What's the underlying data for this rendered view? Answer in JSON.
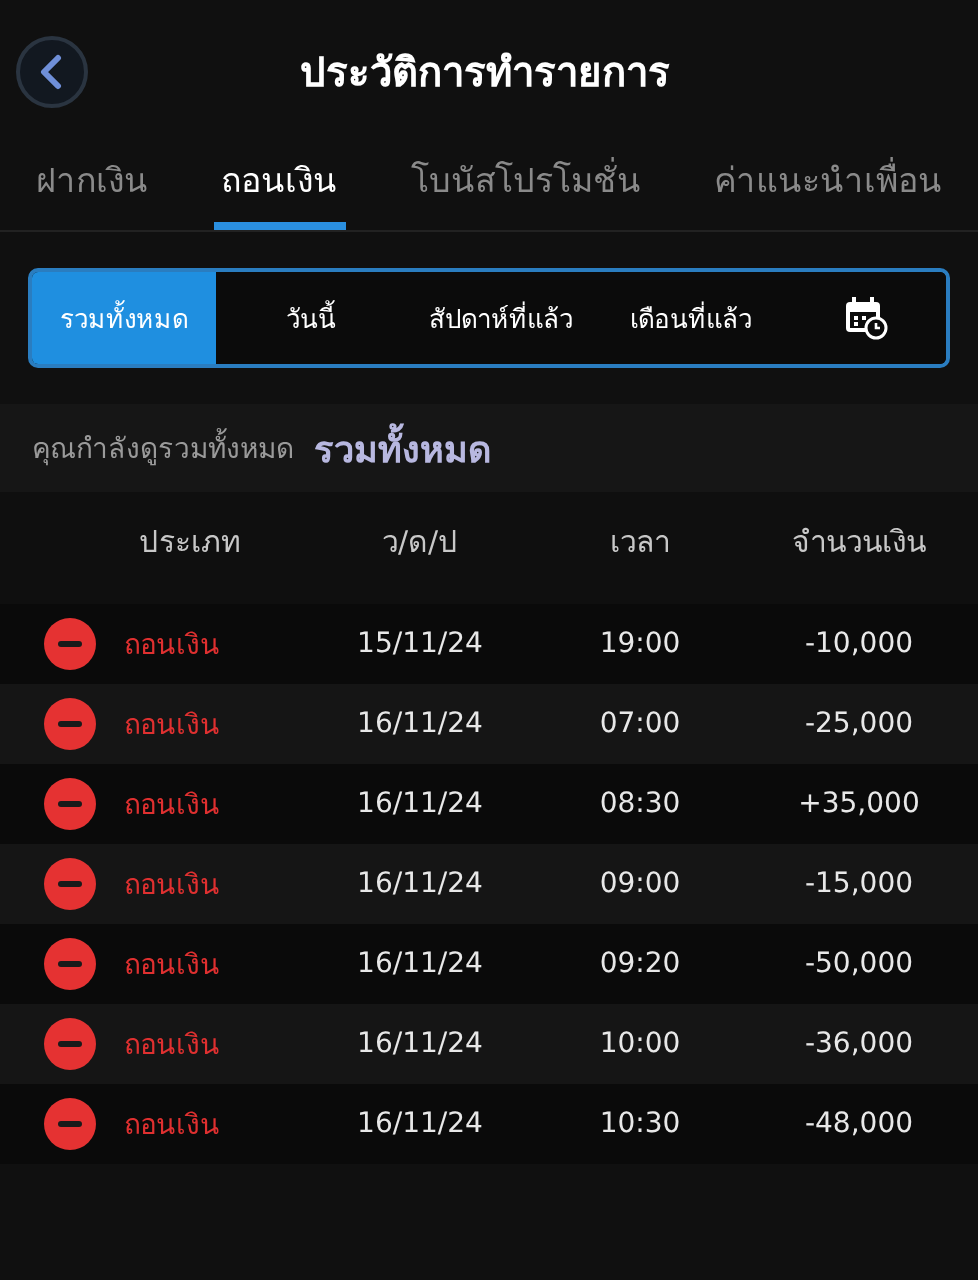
{
  "header": {
    "title": "ประวัติการทำรายการ"
  },
  "tabs": [
    {
      "label": "ฝากเงิน",
      "selected": false
    },
    {
      "label": "ถอนเงิน",
      "selected": true
    },
    {
      "label": "โบนัสโปรโมชั่น",
      "selected": false
    },
    {
      "label": "ค่าแนะนำเพื่อน",
      "selected": false
    }
  ],
  "filters": [
    {
      "label": "รวมทั้งหมด",
      "selected": true
    },
    {
      "label": "วันนี้",
      "selected": false
    },
    {
      "label": "สัปดาห์ที่แล้ว",
      "selected": false
    },
    {
      "label": "เดือนที่แล้ว",
      "selected": false
    }
  ],
  "viewing": {
    "caption": "คุณกำลังดูรวมทั้งหมด",
    "value": "รวมทั้งหมด"
  },
  "table": {
    "columns": [
      "ประเภท",
      "ว/ด/ป",
      "เวลา",
      "จำนวนเงิน"
    ],
    "rows": [
      {
        "kind": "withdraw",
        "type": "ถอนเงิน",
        "date": "15/11/24",
        "time": "19:00",
        "amount": "-10,000"
      },
      {
        "kind": "withdraw",
        "type": "ถอนเงิน",
        "date": "16/11/24",
        "time": "07:00",
        "amount": "-25,000"
      },
      {
        "kind": "withdraw",
        "type": "ถอนเงิน",
        "date": "16/11/24",
        "time": "08:30",
        "amount": "+35,000"
      },
      {
        "kind": "withdraw",
        "type": "ถอนเงิน",
        "date": "16/11/24",
        "time": "09:00",
        "amount": "-15,000"
      },
      {
        "kind": "withdraw",
        "type": "ถอนเงิน",
        "date": "16/11/24",
        "time": "09:20",
        "amount": "-50,000"
      },
      {
        "kind": "withdraw",
        "type": "ถอนเงิน",
        "date": "16/11/24",
        "time": "10:00",
        "amount": "-36,000"
      },
      {
        "kind": "withdraw",
        "type": "ถอนเงิน",
        "date": "16/11/24",
        "time": "10:30",
        "amount": "-48,000"
      }
    ]
  }
}
